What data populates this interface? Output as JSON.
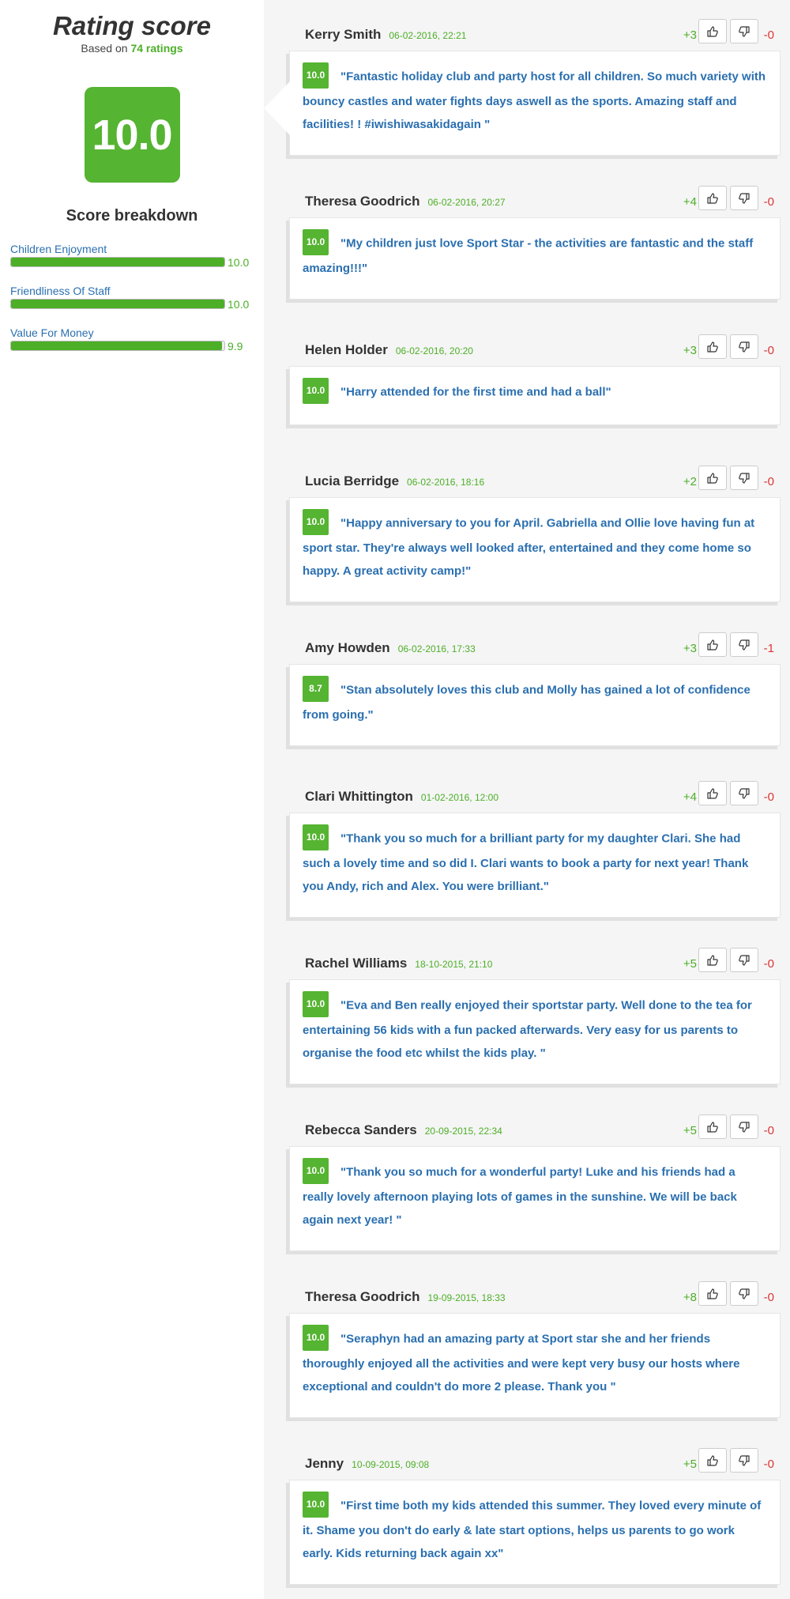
{
  "summary": {
    "title": "Rating score",
    "based_on_prefix": "Based on",
    "based_on_count": "74 ratings",
    "score": "10.0",
    "breakdown_title": "Score breakdown",
    "breakdown": [
      {
        "label": "Children Enjoyment",
        "value": "10.0",
        "fraction": 1.0
      },
      {
        "label": "Friendliness Of Staff",
        "value": "10.0",
        "fraction": 1.0
      },
      {
        "label": "Value For Money",
        "value": "9.9",
        "fraction": 0.99
      }
    ]
  },
  "colors": {
    "accent": "#55b431",
    "link": "#2a6fb0",
    "negative": "#dd3333"
  },
  "reviews": [
    {
      "name": "Kerry Smith",
      "date": "06-02-2016, 22:21",
      "up": "+3",
      "down": "-0",
      "score": "10.0",
      "text": "\"Fantastic holiday club and party host for all children. So much variety with bouncy castles and water fights days aswell as the sports. Amazing staff and facilities! ! #iwishiwasakidagain \""
    },
    {
      "name": "Theresa Goodrich",
      "date": "06-02-2016, 20:27",
      "up": "+4",
      "down": "-0",
      "score": "10.0",
      "text": "\"My children just love Sport Star - the activities are fantastic and the staff amazing!!!\""
    },
    {
      "name": "Helen Holder",
      "date": "06-02-2016, 20:20",
      "up": "+3",
      "down": "-0",
      "score": "10.0",
      "text": "\"Harry attended for the first time and had a ball\""
    },
    {
      "name": "Lucia Berridge",
      "date": "06-02-2016, 18:16",
      "up": "+2",
      "down": "-0",
      "score": "10.0",
      "text": "\"Happy anniversary to you for April. Gabriella and Ollie love having fun at sport star. They're always well looked after, entertained and they come home so happy. A great activity camp!\""
    },
    {
      "name": "Amy Howden",
      "date": "06-02-2016, 17:33",
      "up": "+3",
      "down": "-1",
      "score": "8.7",
      "text": "\"Stan absolutely loves this club and Molly has gained a lot of confidence from going.\""
    },
    {
      "name": "Clari Whittington",
      "date": "01-02-2016, 12:00",
      "up": "+4",
      "down": "-0",
      "score": "10.0",
      "text": "\"Thank you so much for a brilliant party for my daughter Clari. She had such a lovely time and so did I. Clari wants to book a party for next year! Thank you Andy, rich and Alex. You were brilliant.\""
    },
    {
      "name": "Rachel Williams",
      "date": "18-10-2015, 21:10",
      "up": "+5",
      "down": "-0",
      "score": "10.0",
      "text": "\"Eva and Ben really enjoyed their sportstar party. Well done to the tea for entertaining 56 kids with a fun packed afterwards. Very easy for us parents to organise the food etc whilst the kids play. \""
    },
    {
      "name": "Rebecca Sanders",
      "date": "20-09-2015, 22:34",
      "up": "+5",
      "down": "-0",
      "score": "10.0",
      "text": "\"Thank you so much for a wonderful party! Luke and his friends had a really lovely afternoon playing lots of games in the sunshine. We will be back again next year! \""
    },
    {
      "name": "Theresa Goodrich",
      "date": "19-09-2015, 18:33",
      "up": "+8",
      "down": "-0",
      "score": "10.0",
      "text": "\"Seraphyn had an amazing party at Sport star she and her friends thoroughly enjoyed all the activities and were kept very busy our hosts where exceptional and couldn't do more 2 please. Thank you \""
    },
    {
      "name": "Jenny",
      "date": "10-09-2015, 09:08",
      "up": "+5",
      "down": "-0",
      "score": "10.0",
      "text": "\"First time both my kids attended this summer. They loved every minute of it. Shame you don't do early & late start options, helps us parents to go work early. Kids returning back again xx\""
    }
  ]
}
